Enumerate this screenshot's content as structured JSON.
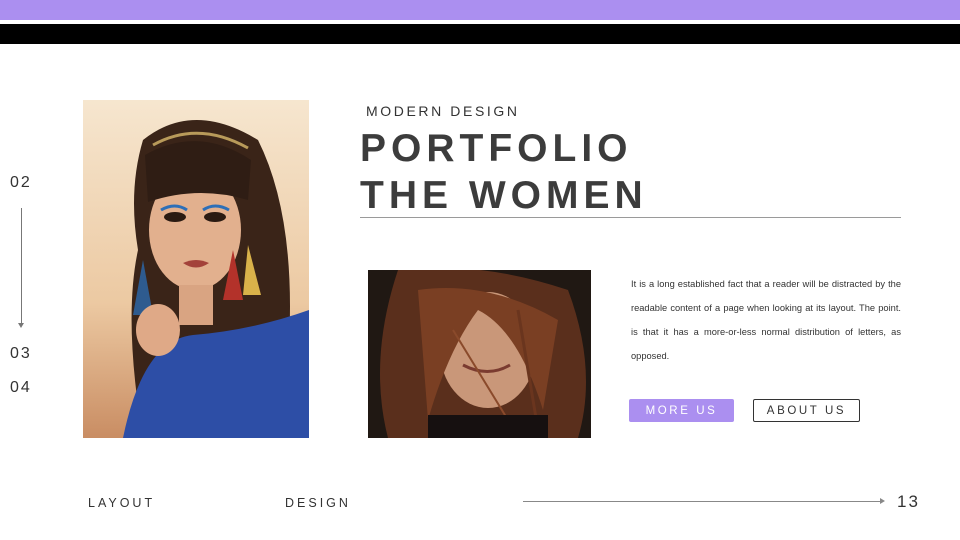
{
  "colors": {
    "accent": "#ab8ff0",
    "band_dark": "#000000",
    "text": "#3a3a3a"
  },
  "side_nav": {
    "items": [
      {
        "label": "02"
      },
      {
        "label": "03"
      },
      {
        "label": "04"
      }
    ]
  },
  "header": {
    "subtitle": "MODERN DESIGN",
    "title_line1": "PORTFOLIO",
    "title_line2": "THE WOMEN"
  },
  "images": {
    "main": {
      "description": "portrait of woman with bangs and colorful tassel headpiece, blue top"
    },
    "small": {
      "description": "smiling woman with hair blowing across face"
    }
  },
  "body": {
    "text": "It is a long established fact that a reader will be distracted by the readable content of a page when looking at its layout. The point. is that it has a more-or-less normal distribution of letters, as opposed."
  },
  "buttons": {
    "more_label": "MORE US",
    "about_label": "ABOUT US"
  },
  "footer": {
    "left_label": "LAYOUT",
    "center_label": "DESIGN",
    "page_number": "13"
  }
}
